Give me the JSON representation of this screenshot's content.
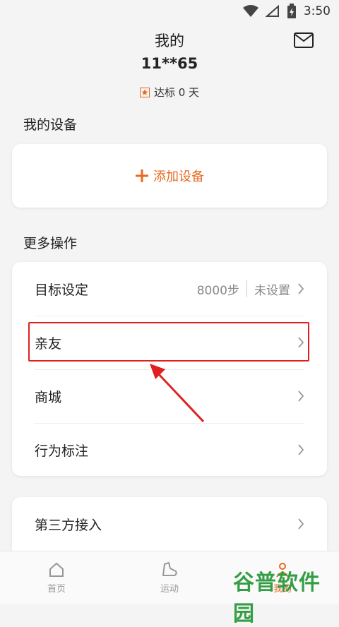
{
  "status": {
    "time": "3:50"
  },
  "header": {
    "title": "我的",
    "user": "11**65",
    "streak_label": "达标 0 天"
  },
  "devices": {
    "section_title": "我的设备",
    "add_label": "添加设备"
  },
  "more": {
    "section_title": "更多操作",
    "items": [
      {
        "label": "目标设定",
        "value": "8000步",
        "status": "未设置"
      },
      {
        "label": "亲友"
      },
      {
        "label": "商城"
      },
      {
        "label": "行为标注"
      }
    ]
  },
  "third_party": {
    "label": "第三方接入"
  },
  "tabs": [
    {
      "label": "首页",
      "icon": "home-icon"
    },
    {
      "label": "运动",
      "icon": "shoe-icon"
    },
    {
      "label": "我的",
      "icon": "person-icon"
    }
  ],
  "watermark": "谷普软件园",
  "colors": {
    "accent": "#e8681f",
    "highlight": "#e02020",
    "watermark": "#2a9a3c"
  }
}
